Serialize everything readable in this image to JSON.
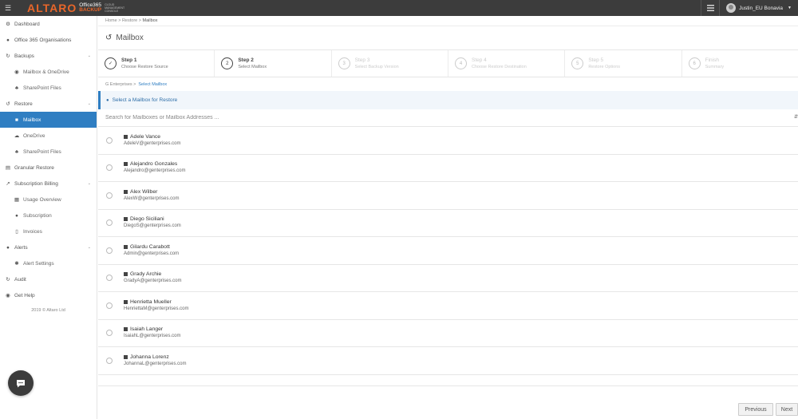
{
  "topbar": {
    "logo": "ALTARO",
    "logo_line1": "Office365",
    "logo_line2": "BACKUP",
    "logo_cloud": [
      "CLOUD",
      "MANAGEMENT",
      "CONSOLE"
    ],
    "user_name": "Justin_EU Bonavia"
  },
  "sidebar": {
    "items": [
      {
        "label": "Dashboard",
        "icon": "dashboard-icon"
      },
      {
        "label": "Office 365 Organisations",
        "icon": "globe-icon"
      },
      {
        "label": "Backups",
        "icon": "backup-icon"
      },
      {
        "label": "Mailbox & OneDrive",
        "icon": "user-icon"
      },
      {
        "label": "SharePoint Files",
        "icon": "sitemap-icon"
      },
      {
        "label": "Restore",
        "icon": "restore-icon"
      },
      {
        "label": "Mailbox",
        "icon": "mailbox-icon"
      },
      {
        "label": "OneDrive",
        "icon": "cloud-icon"
      },
      {
        "label": "SharePoint Files",
        "icon": "sitemap-icon"
      },
      {
        "label": "Granular Restore",
        "icon": "book-icon"
      },
      {
        "label": "Subscription Billing",
        "icon": "chart-icon"
      },
      {
        "label": "Usage Overview",
        "icon": "bar-chart-icon"
      },
      {
        "label": "Subscription",
        "icon": "dot-icon"
      },
      {
        "label": "Invoices",
        "icon": "file-icon"
      },
      {
        "label": "Alerts",
        "icon": "alert-icon"
      },
      {
        "label": "Alert Settings",
        "icon": "gear-icon"
      },
      {
        "label": "Audit",
        "icon": "history-icon"
      },
      {
        "label": "Get Help",
        "icon": "help-icon"
      }
    ],
    "copyright": "2019 © Altaro Ltd"
  },
  "breadcrumb": {
    "home": "Home",
    "restore": "Restore",
    "current": "Mailbox"
  },
  "page": {
    "title": "Mailbox"
  },
  "wizard": {
    "steps": [
      {
        "title": "Step 1",
        "sub": "Choose Restore Source",
        "marker": "✓"
      },
      {
        "title": "Step 2",
        "sub": "Select Mailbox",
        "marker": "2"
      },
      {
        "title": "Step 3",
        "sub": "Select Backup Version",
        "marker": "3"
      },
      {
        "title": "Step 4",
        "sub": "Choose Restore Destination",
        "marker": "4"
      },
      {
        "title": "Step 5",
        "sub": "Restore Options",
        "marker": "5"
      },
      {
        "title": "Finish",
        "sub": "Summary",
        "marker": "6"
      }
    ]
  },
  "subcrumb": {
    "org": "G Enterprises",
    "current": "Select Mailbox"
  },
  "info": {
    "text": "Select a Mailbox for Restore"
  },
  "search": {
    "placeholder": "Search for Mailboxes or Mailbox Addresses ..."
  },
  "mailboxes": [
    {
      "name": "Adele Vance",
      "email": "AdeleV@genterprises.com"
    },
    {
      "name": "Alejandro Gonzales",
      "email": "Alejandro@genterprises.com"
    },
    {
      "name": "Alex Wilber",
      "email": "AlexW@genterprises.com"
    },
    {
      "name": "Diego Siciliani",
      "email": "DiegoS@genterprises.com"
    },
    {
      "name": "Gilardu Carabott",
      "email": "Admin@genterprises.com"
    },
    {
      "name": "Grady Archie",
      "email": "GradyA@genterprises.com"
    },
    {
      "name": "Henrietta Mueller",
      "email": "HenriettaM@genterprises.com"
    },
    {
      "name": "Isaiah Langer",
      "email": "IsaiahL@genterprises.com"
    },
    {
      "name": "Johanna Lorenz",
      "email": "JohannaL@genterprises.com"
    }
  ],
  "footer": {
    "previous": "Previous",
    "next": "Next"
  }
}
